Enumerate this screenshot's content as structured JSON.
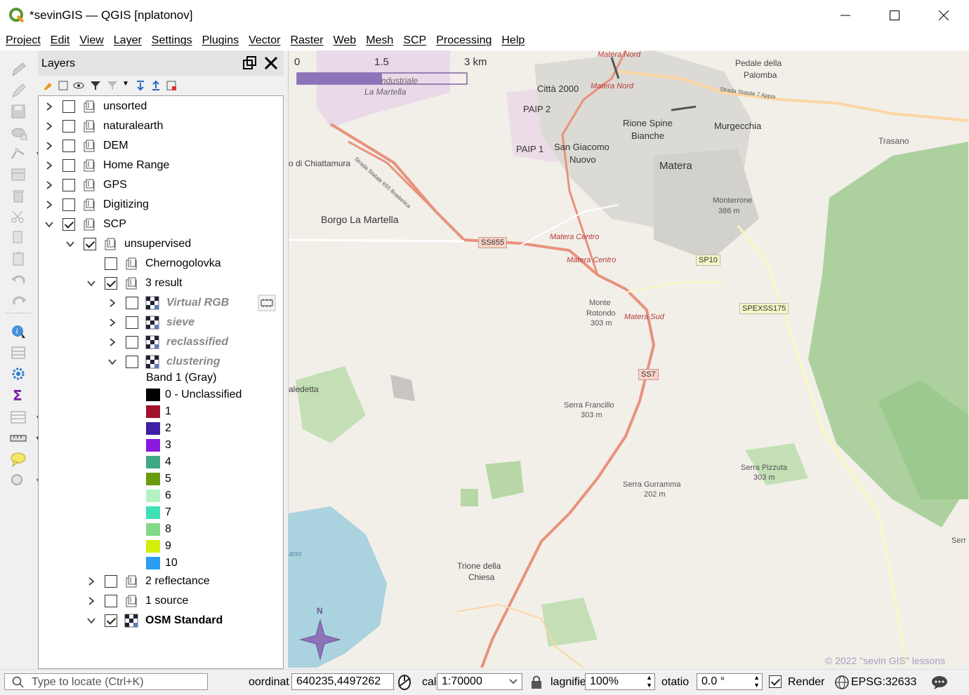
{
  "window": {
    "title": "*sevinGIS — QGIS [nplatonov]"
  },
  "menu": [
    "Project",
    "Edit",
    "View",
    "Layer",
    "Settings",
    "Plugins",
    "Vector",
    "Raster",
    "Web",
    "Mesh",
    "SCP",
    "Processing",
    "Help"
  ],
  "layers_panel": {
    "title": "Layers",
    "groups": [
      {
        "label": "unsorted",
        "checked": false
      },
      {
        "label": "naturalearth",
        "checked": false
      },
      {
        "label": "DEM",
        "checked": false
      },
      {
        "label": "Home Range",
        "checked": false
      },
      {
        "label": "GPS",
        "checked": false
      },
      {
        "label": "Digitizing",
        "checked": false
      },
      {
        "label": "SCP",
        "checked": true
      },
      {
        "label": "unsupervised",
        "checked": true
      },
      {
        "label": "Chernogolovka",
        "checked": false
      },
      {
        "label": "3 result",
        "checked": true
      },
      {
        "label": "Virtual RGB",
        "checked": false
      },
      {
        "label": "sieve",
        "checked": false
      },
      {
        "label": "reclassified",
        "checked": false
      },
      {
        "label": "clustering",
        "checked": false
      },
      {
        "label": "2 reflectance",
        "checked": false
      },
      {
        "label": "1 source",
        "checked": false
      },
      {
        "label": "OSM Standard",
        "checked": true
      }
    ],
    "band_label": "Band 1 (Gray)",
    "legend": [
      {
        "label": "0 - Unclassified",
        "color": "#000000"
      },
      {
        "label": "1",
        "color": "#a1132c"
      },
      {
        "label": "2",
        "color": "#3c1fa6"
      },
      {
        "label": "3",
        "color": "#8b1ae0"
      },
      {
        "label": "4",
        "color": "#3fa886"
      },
      {
        "label": "5",
        "color": "#6a9a0e"
      },
      {
        "label": "6",
        "color": "#b4f2c4"
      },
      {
        "label": "7",
        "color": "#3ee0b6"
      },
      {
        "label": "8",
        "color": "#82d887"
      },
      {
        "label": "9",
        "color": "#d2ee0a"
      },
      {
        "label": "10",
        "color": "#2a9ef0"
      }
    ]
  },
  "map": {
    "scale_labels": [
      "0",
      "1.5",
      "3 km"
    ],
    "places": [
      {
        "name": "Matera Nord"
      },
      {
        "name": "Matera Nord"
      },
      {
        "name": "Pedale della"
      },
      {
        "name": "Palomba"
      },
      {
        "name": "Strada Statale 7 Appia"
      },
      {
        "name": "ndustriale"
      },
      {
        "name": "La Martella"
      },
      {
        "name": "Città 2000"
      },
      {
        "name": "PAIP 2"
      },
      {
        "name": "Rione Spine"
      },
      {
        "name": "Bianche"
      },
      {
        "name": "Murgecchia"
      },
      {
        "name": "Trasano"
      },
      {
        "name": "PAIP 1"
      },
      {
        "name": "San Giacomo"
      },
      {
        "name": "Nuovo"
      },
      {
        "name": "Matera"
      },
      {
        "name": "o di Chiattamura"
      },
      {
        "name": "Monterrone"
      },
      {
        "name": "386 m"
      },
      {
        "name": "Borgo La Martella"
      },
      {
        "name": "SS655"
      },
      {
        "name": "Matera Centro"
      },
      {
        "name": "Matera Centro"
      },
      {
        "name": "SP10"
      },
      {
        "name": "SPEXSS175"
      },
      {
        "name": "Monte"
      },
      {
        "name": "Rotondo"
      },
      {
        "name": "303 m"
      },
      {
        "name": "Matera Sud"
      },
      {
        "name": "SS7"
      },
      {
        "name": "aledetta"
      },
      {
        "name": "Serra Francillo"
      },
      {
        "name": "303 m"
      },
      {
        "name": "Serra Pizzuta"
      },
      {
        "name": "303 m"
      },
      {
        "name": "Serra Gurramma"
      },
      {
        "name": "202 m"
      },
      {
        "name": "Trione della"
      },
      {
        "name": "Chiesa"
      },
      {
        "name": "ano"
      },
      {
        "name": "Serr"
      },
      {
        "name": "N"
      },
      {
        "name": "Strada Statale 655 Bradanica"
      }
    ],
    "copyright": "© 2022 \"sevin GIS\" lessons"
  },
  "status": {
    "locate_placeholder": "Type to locate (Ctrl+K)",
    "coord_label": "oordinat",
    "coord_value": "640235,4497262",
    "scale_label": "cal",
    "scale_value": "1:70000",
    "magnifier_label": "lagnifie",
    "magnifier_value": "100%",
    "rotation_label": "otatio",
    "rotation_value": "0.0 °",
    "render_label": "Render",
    "crs": "EPSG:32633"
  }
}
